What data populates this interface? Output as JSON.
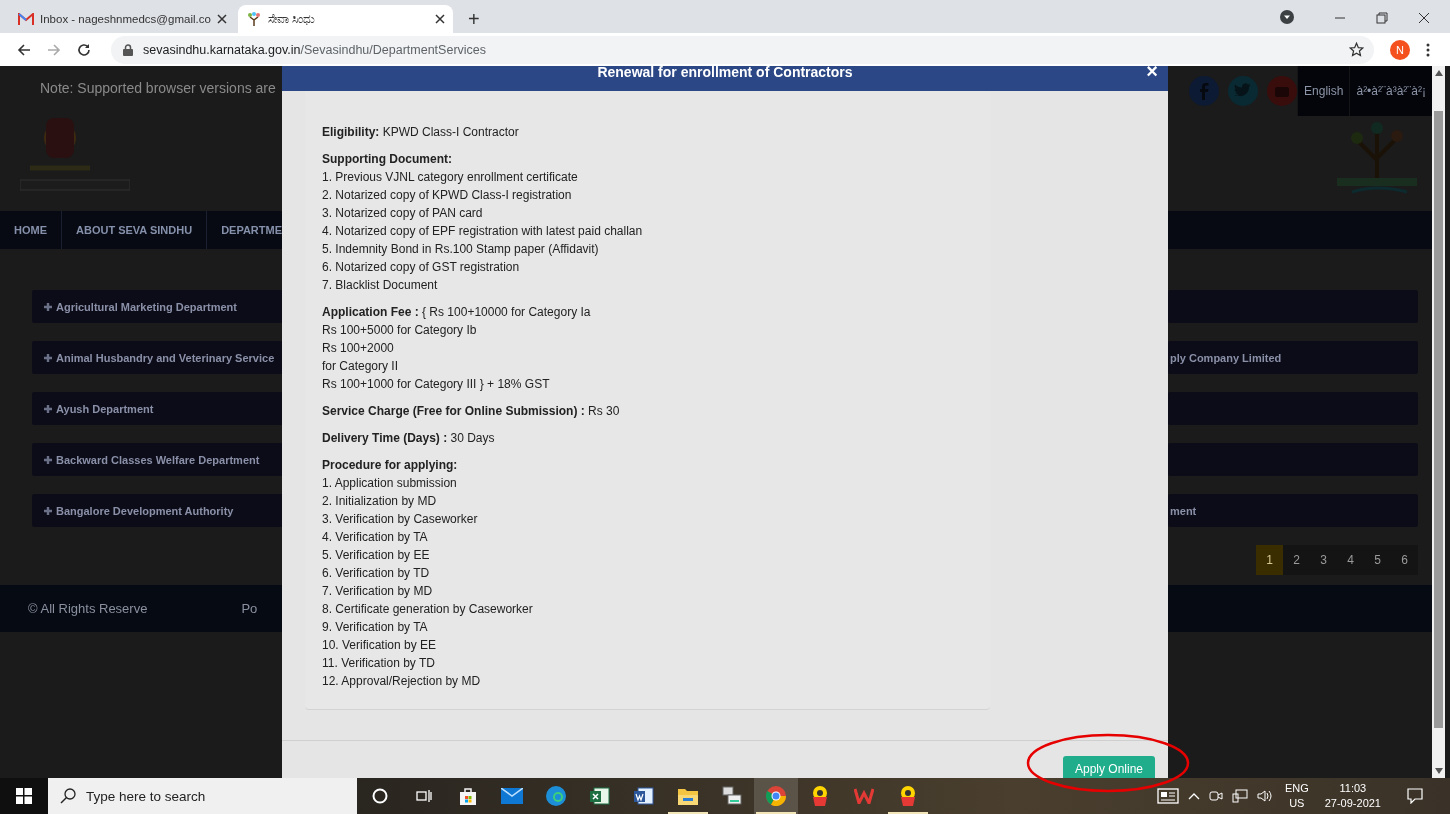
{
  "browser": {
    "tabs": [
      {
        "title": "Inbox - nageshnmedcs@gmail.co",
        "selected": false
      },
      {
        "title": "ಸೇವಾ ಸಿಂಧು",
        "selected": true
      }
    ],
    "new_tab": "+",
    "url_host": "sevasindhu.karnataka.gov.in",
    "url_path": "/Sevasindhu/DepartmentServices",
    "profile": "N"
  },
  "page": {
    "note": "Note: Supported browser versions are",
    "languages": [
      "English",
      "à²•à²¨à³à²¨à²¡"
    ],
    "nav": [
      "HOME",
      "ABOUT SEVA SINDHU",
      "DEPARTME"
    ],
    "departments": [
      {
        "left": "Agricultural Marketing Department"
      },
      {
        "left": "Animal Husbandry and Veterinary Service",
        "right": "ply Company Limited"
      },
      {
        "left": "Ayush Department"
      },
      {
        "left": "Backward Classes Welfare Department"
      },
      {
        "left": "Bangalore Development Authority",
        "right": "ment"
      }
    ],
    "pagination": [
      {
        "label": "1",
        "selected": true
      },
      {
        "label": "2",
        "selected": false
      },
      {
        "label": "3",
        "selected": false
      },
      {
        "label": "4",
        "selected": false
      },
      {
        "label": "5",
        "selected": false
      },
      {
        "label": "6",
        "selected": false
      }
    ],
    "footer": [
      "© All Rights Reserve",
      "Po"
    ]
  },
  "modal": {
    "title": "Renewal for enrollment of Contractors",
    "close": "×",
    "sections": [
      {
        "text": "**Eligibility:** KPWD Class-I Contractor"
      },
      {
        "text": "**Supporting Document:**",
        "lines": [
          "1. Previous VJNL category enrollment certificate",
          "2. Notarized copy of KPWD Class-I registration",
          "3. Notarized copy of PAN card",
          "4. Notarized copy of EPF registration with latest paid challan",
          "5. Indemnity Bond in Rs.100 Stamp paper (Affidavit)",
          "6. Notarized copy of GST registration",
          "7. Blacklist Document"
        ]
      },
      {
        "text": "**Application Fee :** { Rs 100+10000 for Category Ia",
        "lines": [
          "Rs 100+5000 for Category Ib",
          "Rs 100+2000",
          "for Category II",
          "Rs 100+1000 for Category III } + 18% GST"
        ]
      },
      {
        "text": "**Service Charge (Free for Online Submission) :** Rs 30"
      },
      {
        "text": "**Delivery Time (Days) :** 30 Days"
      },
      {
        "text": "**Procedure for applying:**",
        "lines": [
          "1. Application submission",
          "2. Initialization by MD",
          "3. Verification by Caseworker",
          "4. Verification by TA",
          "5. Verification by EE",
          "6. Verification by TD",
          "7. Verification by MD",
          "8. Certificate generation by Caseworker",
          "9. Verification by TA",
          "10. Verification by EE",
          "11. Verification by TD",
          "12. Approval/Rejection by MD"
        ]
      }
    ],
    "apply_button": "Apply Online"
  },
  "annotation": {
    "kind": "ellipse"
  },
  "taskbar": {
    "search_placeholder": "Type here to search",
    "apps": [
      {
        "kind": "cortana",
        "running": false,
        "selected": false
      },
      {
        "kind": "taskview",
        "running": false,
        "selected": false
      },
      {
        "kind": "store",
        "running": false,
        "selected": false
      },
      {
        "kind": "mail",
        "running": false,
        "selected": false
      },
      {
        "kind": "edge",
        "running": false,
        "selected": false
      },
      {
        "kind": "excel",
        "running": false,
        "selected": false
      },
      {
        "kind": "word",
        "running": false,
        "selected": false
      },
      {
        "kind": "explorer",
        "running": true,
        "selected": false
      },
      {
        "kind": "files",
        "running": false,
        "selected": false
      },
      {
        "kind": "chrome",
        "running": true,
        "selected": true
      },
      {
        "kind": "kannada",
        "running": false,
        "selected": false
      },
      {
        "kind": "wps",
        "running": false,
        "selected": false
      },
      {
        "kind": "kannada",
        "running": true,
        "selected": false
      }
    ],
    "language": [
      "ENG",
      "US"
    ],
    "time": "11:03",
    "date": "27-09-2021"
  }
}
